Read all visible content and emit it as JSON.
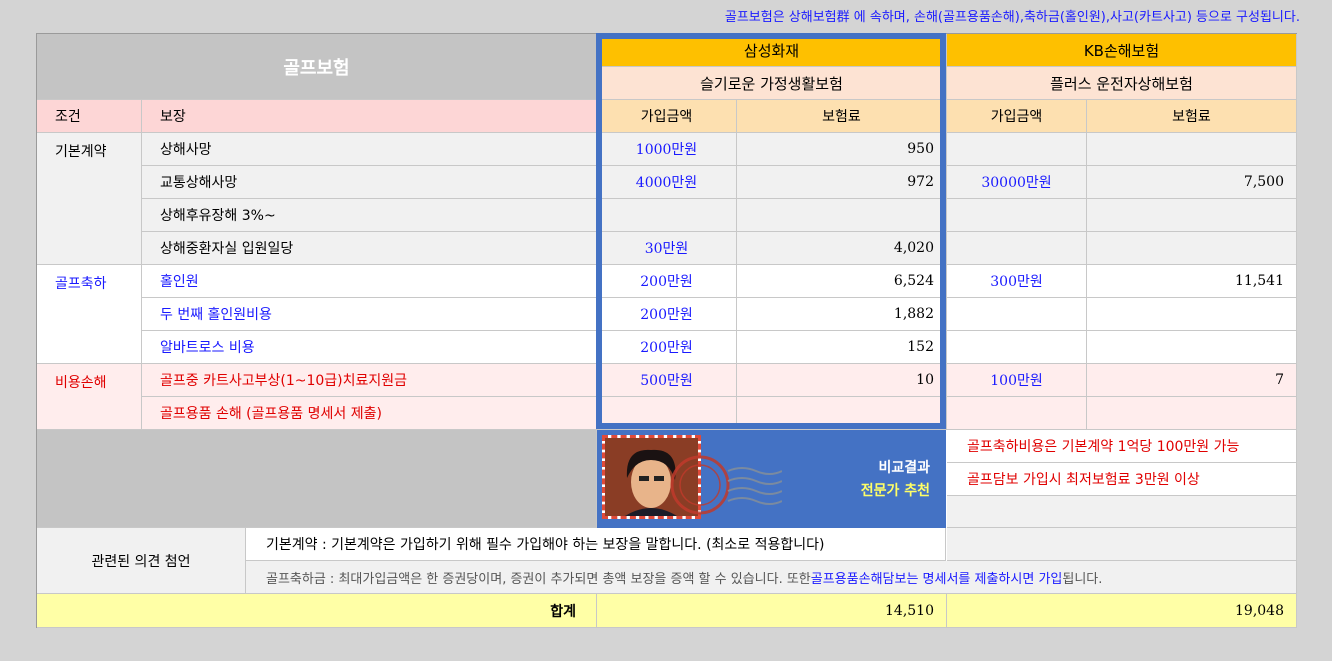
{
  "header_note": "골프보험은 상해보험群 에 속하며, 손해(골프용품손해),축하금(홀인원),사고(카트사고) 등으로 구성됩니다.",
  "title": "골프보험",
  "col_headers": {
    "condition": "조건",
    "coverage": "보장",
    "amount": "가입금액",
    "premium": "보험료"
  },
  "insurers": [
    {
      "company": "삼성화재",
      "product": "슬기로운 가정생활보험"
    },
    {
      "company": "KB손해보험",
      "product": "플러스 운전자상해보험"
    }
  ],
  "groups": [
    {
      "name": "기본계약",
      "color": "#000000"
    },
    {
      "name": "골프축하",
      "color": "#1a1aff"
    },
    {
      "name": "비용손해",
      "color": "#e00000"
    }
  ],
  "rows": [
    {
      "coverage": "상해사망",
      "s_amount": "1000만원",
      "s_premium": "950",
      "k_amount": "",
      "k_premium": ""
    },
    {
      "coverage": "교통상해사망",
      "s_amount": "4000만원",
      "s_premium": "972",
      "k_amount": "30000만원",
      "k_premium": "7,500"
    },
    {
      "coverage": "상해후유장해 3%~",
      "s_amount": "",
      "s_premium": "",
      "k_amount": "",
      "k_premium": ""
    },
    {
      "coverage": "상해중환자실 입원일당",
      "s_amount": "30만원",
      "s_premium": "4,020",
      "k_amount": "",
      "k_premium": ""
    },
    {
      "coverage": "홀인원",
      "s_amount": "200만원",
      "s_premium": "6,524",
      "k_amount": "300만원",
      "k_premium": "11,541"
    },
    {
      "coverage": "두 번째 홀인원비용",
      "s_amount": "200만원",
      "s_premium": "1,882",
      "k_amount": "",
      "k_premium": ""
    },
    {
      "coverage": "알바트로스 비용",
      "s_amount": "200만원",
      "s_premium": "152",
      "k_amount": "",
      "k_premium": ""
    },
    {
      "coverage": "골프중 카트사고부상(1~10급)치료지원금",
      "s_amount": "500만원",
      "s_premium": "10",
      "k_amount": "100만원",
      "k_premium": "7"
    },
    {
      "coverage": "골프용품 손해 (골프용품 명세서 제출)",
      "s_amount": "",
      "s_premium": "",
      "k_amount": "",
      "k_premium": ""
    }
  ],
  "recommend": {
    "line1": "비교결과",
    "line2": "전문가 추천"
  },
  "kb_notes": [
    "골프축하비용은 기본계약 1억당 100만원 가능",
    "골프담보 가입시 최저보험료 3만원 이상"
  ],
  "opinion_label": "관련된 의견 첨언",
  "opinion1": "기본계약 : 기본계약은  가입하기 위해 필수 가입해야 하는 보장을 말합니다. (최소로 적용합니다)",
  "opinion2_a": "골프축하금 : 최대가입금액은 한 증권당이며, 증권이 추가되면 총액 보장을 증액 할 수 있습니다. 또한 ",
  "opinion2_b": "골프용품손해담보는 명세서를 제출하시면 가입",
  "opinion2_c": "됩니다.",
  "total_label": "합계",
  "totals": {
    "samsung": "14,510",
    "kb": "19,048"
  }
}
